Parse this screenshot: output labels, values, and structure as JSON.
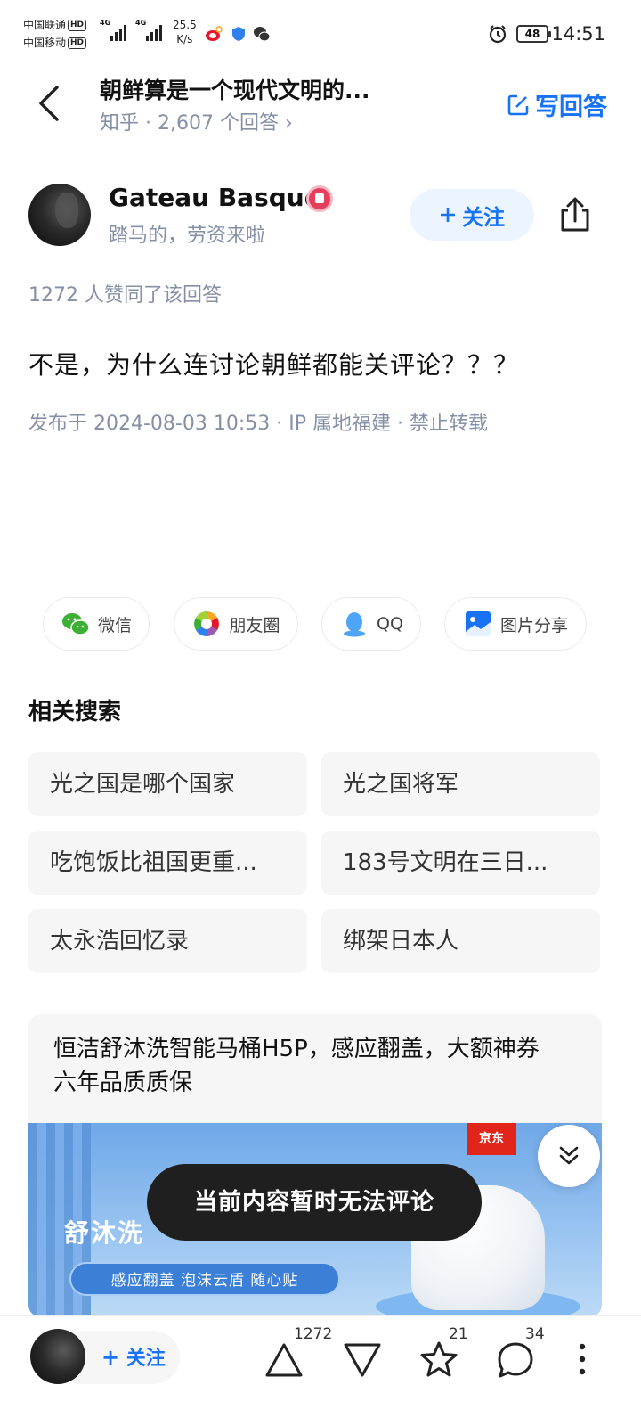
{
  "status_bar": {
    "carrier1": "中国联通",
    "carrier2": "中国移动",
    "hd": "HD",
    "net": "4G",
    "speed_value": "25.5",
    "speed_unit": "K/s",
    "battery": "48",
    "time": "14:51"
  },
  "header": {
    "title": "朝鲜算是一个现代文明的...",
    "subtitle": "知乎 · 2,607 个回答 ›",
    "write_answer": "写回答"
  },
  "author": {
    "name": "Gateau Basque",
    "bio": "踏马的，劳资来啦",
    "follow_label": "关注"
  },
  "answer": {
    "votes_line": "1272 人赞同了该回答",
    "text": "不是，为什么连讨论朝鲜都能关评论？？？",
    "publish_line": "发布于 2024-08-03 10:53 · IP 属地福建 · 禁止转载"
  },
  "share": {
    "wechat": "微信",
    "moments": "朋友圈",
    "qq": "QQ",
    "image_share": "图片分享"
  },
  "related": {
    "title": "相关搜索",
    "items": [
      "光之国是哪个国家",
      "光之国将军",
      "吃饱饭比祖国更重...",
      "183号文明在三日...",
      "太永浩回忆录",
      "绑架日本人"
    ]
  },
  "ad": {
    "text": "恒洁舒沐洗智能马桶H5P，感应翻盖，大额神券 六年品质质保",
    "slogan": "舒沐洗 ",
    "pill": "感应翻盖  泡沫云盾  随心贴",
    "jd": "京东"
  },
  "toast": "当前内容暂时无法评论",
  "bottom_bar": {
    "follow_label": "关注",
    "upvote_count": "1272",
    "favorite_count": "21",
    "comment_count": "34"
  },
  "colors": {
    "accent": "#1772f6",
    "muted": "#8590a6",
    "toast_bg": "#1f1f1f"
  }
}
